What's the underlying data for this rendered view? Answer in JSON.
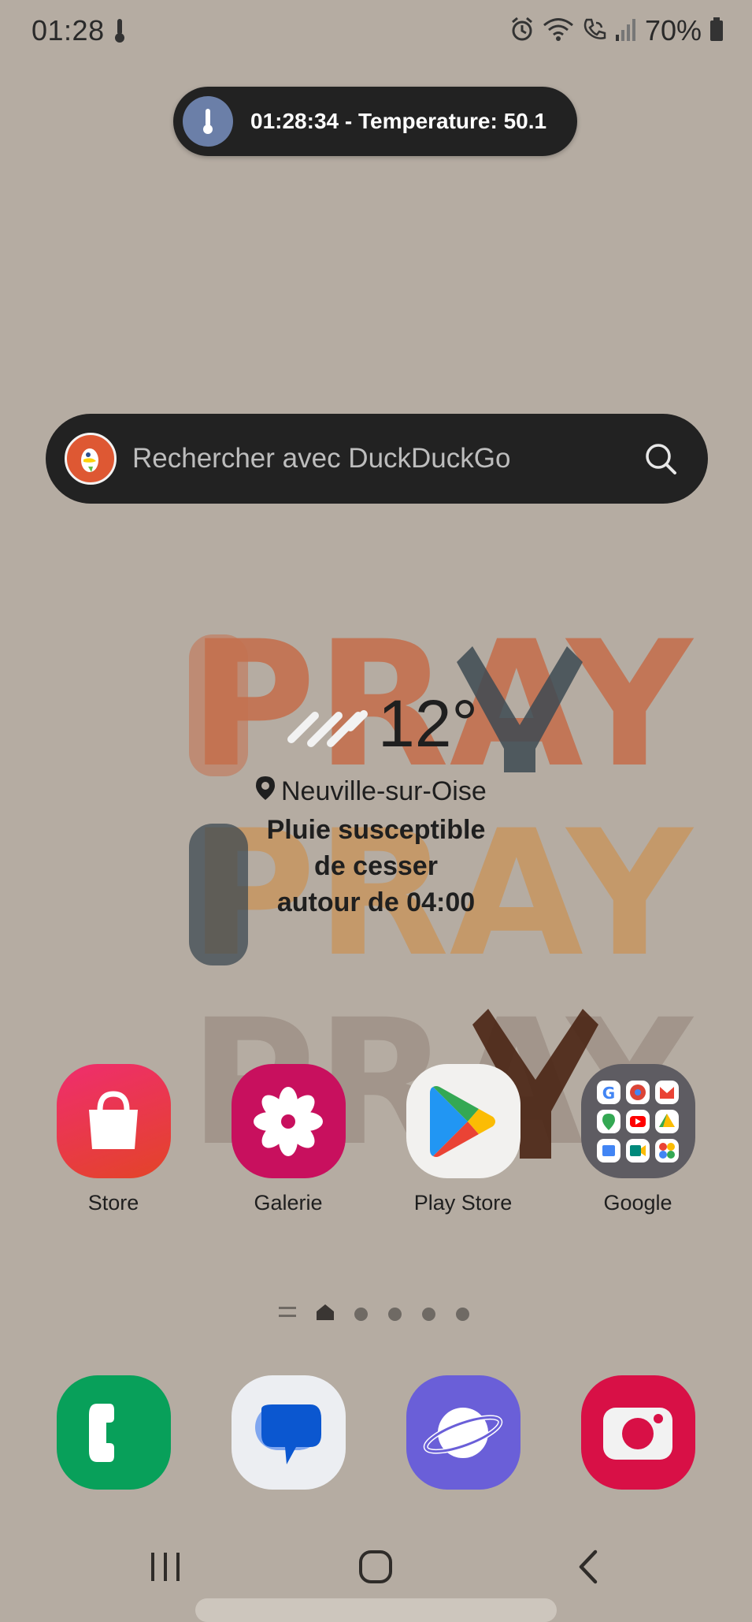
{
  "status_bar": {
    "time": "01:28",
    "battery": "70%",
    "icons": [
      "thermometer-icon",
      "alarm-icon",
      "wifi-icon",
      "wifi-call-icon",
      "signal-icon",
      "battery-icon"
    ]
  },
  "toast": {
    "text": "01:28:34 - Temperature: 50.1",
    "icon": "thermometer-icon"
  },
  "search": {
    "placeholder": "Rechercher avec DuckDuckGo",
    "logo": "duckduckgo-logo",
    "button_icon": "search-icon"
  },
  "weather": {
    "temperature": "12°",
    "location": "Neuville-sur-Oise",
    "description_lines": [
      "Pluie susceptible",
      "de cesser",
      "autour de 04:00"
    ]
  },
  "wallpaper": {
    "text": [
      "PRAY",
      "PRAY",
      "PRAY"
    ]
  },
  "apps": [
    {
      "label": "Store",
      "icon": "shopping-bag-icon",
      "color": "#e8365a"
    },
    {
      "label": "Galerie",
      "icon": "flower-icon",
      "color": "#c8105e"
    },
    {
      "label": "Play Store",
      "icon": "play-store-icon",
      "color": "#f2f1ef"
    },
    {
      "label": "Google",
      "icon": "google-folder-icon",
      "color": "#5e5c62"
    }
  ],
  "dock": [
    {
      "icon": "phone-icon",
      "color": "#08a05a"
    },
    {
      "icon": "messages-icon",
      "color": "#eceef2"
    },
    {
      "icon": "internet-icon",
      "color": "#6a5fd8"
    },
    {
      "icon": "camera-icon",
      "color": "#d81046"
    }
  ],
  "page_indicator": {
    "active_page": 1,
    "page_count": 5
  },
  "nav": {
    "recents": "recents-icon",
    "home": "home-icon",
    "back": "back-icon"
  }
}
